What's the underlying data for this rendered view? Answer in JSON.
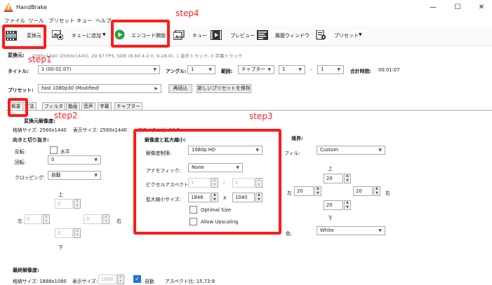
{
  "window": {
    "title": "HandBrake",
    "minimize": "—",
    "maximize": "☐",
    "close": "✕"
  },
  "menu": [
    "ファイル",
    "ツール",
    "プリセット",
    "キュー",
    "ヘルプ"
  ],
  "toolbar": {
    "source": "変換元",
    "add_to_queue": "キューに追加",
    "start_encode": "エンコード開始",
    "queue": "キュー",
    "preview": "プレビュー",
    "activity_log": "履歴ウィンドウ",
    "presets": "プリセット",
    "dropdown_caret": "▼"
  },
  "source_info": {
    "label": "変換元:",
    "value": "2560x1440 (2560x1440), 29.97 FPS, SDR (8-bit 4:2:0, 9-18-9), 1 音声トラック, 0 字幕トラック"
  },
  "title_row": {
    "title_label": "タイトル:",
    "title_value": "1 (00:01:07)",
    "angle_label": "アングル:",
    "angle_value": "1",
    "range_label": "範囲:",
    "range_type": "チャプター",
    "range_from": "1",
    "range_sep": "-",
    "range_to": "1",
    "duration_label": "合計時間:",
    "duration_value": "00:01:07"
  },
  "preset_row": {
    "label": "プリセット:",
    "value": "Fast 1080p30",
    "modified": "(Modified)",
    "arrow": "▶",
    "reload": "再読込",
    "save_new": "新しいプリセットを保存"
  },
  "tabs": [
    "概要",
    "寸法",
    "フィルタ",
    "動画",
    "音声",
    "字幕",
    "チャプター"
  ],
  "dimensions": {
    "source_res_title": "変換元解像度:",
    "storage_size": "格納サイズ: 2560x1440",
    "display_size": "表示サイズ: 2560x1440",
    "aspect": "アスペクト比: 16:9",
    "orientation_title": "向きと切り抜き:",
    "flip_label": "反転:",
    "flip_checkbox": "水平",
    "rotate_label": "回転:",
    "rotate_value": "0",
    "cropping_label": "クロッピング:",
    "cropping_value": "自動",
    "crop_top_label": "上",
    "crop_bottom_label": "下",
    "crop_left_label": "左",
    "crop_right_label": "右",
    "crop_top": "0",
    "crop_bottom": "0",
    "crop_left": "0",
    "crop_right": "0",
    "resolution_title": "解像度と拡大縮小:",
    "res_limit_label": "解像度制限:",
    "res_limit_value": "1080p HD",
    "anamorphic_label": "アナモフィック:",
    "anamorphic_value": "None",
    "par_label": "ピクセルアスペクト比:",
    "par_x": "1",
    "par_sep": ":",
    "par_y": "1",
    "scaled_label": "拡大縮小サイズ:",
    "scaled_w": "1848",
    "scaled_sep": "X",
    "scaled_h": "1040",
    "optimal_size": "Optimal Size",
    "allow_upscaling": "Allow Upscaling",
    "border_title": "境界:",
    "fill_label": "フィル:",
    "fill_value": "Custom",
    "border_top_label": "上",
    "border_bottom_label": "下",
    "border_left_label": "左",
    "border_right_label": "右",
    "border_top": "20",
    "border_bottom": "20",
    "border_left": "20",
    "border_right": "20",
    "color_label": "色:",
    "color_value": "White",
    "final_title": "最終解像度:",
    "final_storage": "格納サイズ: 1888x1080",
    "final_display_label": "表示サイズ:",
    "final_display_value": "1888",
    "final_auto": "自動",
    "final_aspect": "アスペクト比: 15.73:9"
  },
  "annotations": {
    "step1": "step1",
    "step2": "step2",
    "step3": "step3",
    "step4": "step4"
  },
  "colors": {
    "annotation_red": "#ff1a1a",
    "start_green": "#2ea043",
    "checkbox_blue": "#1e73d8"
  }
}
